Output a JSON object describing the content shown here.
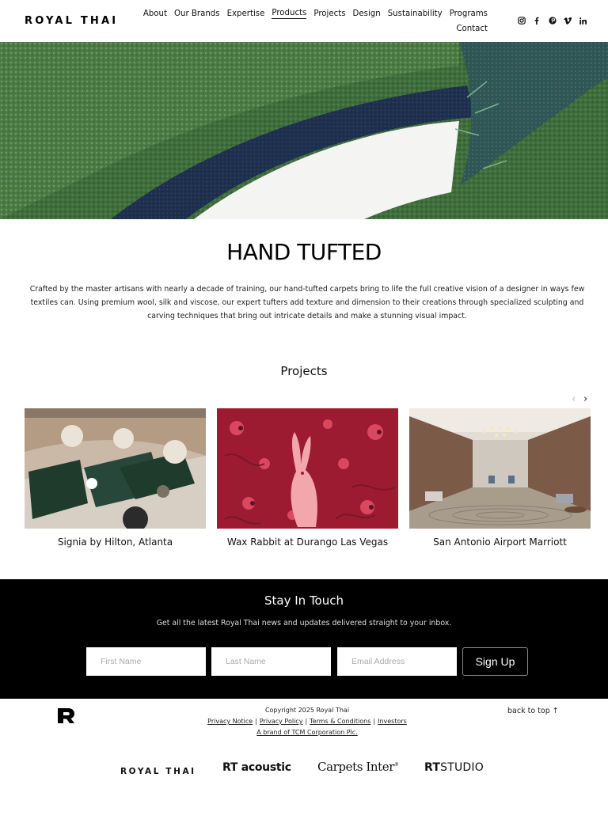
{
  "header": {
    "logo": "ROYAL THAI",
    "nav": [
      {
        "label": "About"
      },
      {
        "label": "Our Brands"
      },
      {
        "label": "Expertise"
      },
      {
        "label": "Products",
        "active": true
      },
      {
        "label": "Projects"
      },
      {
        "label": "Design"
      },
      {
        "label": "Sustainability"
      },
      {
        "label": "Programs"
      },
      {
        "label": "Contact"
      }
    ],
    "social": [
      "instagram-icon",
      "facebook-icon",
      "pinterest-icon",
      "vimeo-icon",
      "linkedin-icon"
    ]
  },
  "hero": {
    "image": "hand-tufted-carpet-closeup"
  },
  "section": {
    "title": "HAND TUFTED",
    "description": "Crafted by the master artisans with nearly a decade of training, our hand-tufted carpets bring to life the full creative vision of a designer in ways few textiles can. Using premium wool, silk and viscose, our expert tufters add texture and dimension to their creations through specialized sculpting and carving techniques that bring out intricate details and make a stunning visual impact."
  },
  "projects": {
    "heading": "Projects",
    "prev": "‹",
    "next": "›",
    "items": [
      {
        "caption": "Signia by Hilton, Atlanta"
      },
      {
        "caption": "Wax Rabbit at Durango Las Vegas"
      },
      {
        "caption": "San Antonio Airport Marriott"
      }
    ]
  },
  "newsletter": {
    "title": "Stay In Touch",
    "subtitle": "Get all the latest Royal Thai news and updates delivered straight to your inbox.",
    "first_name_placeholder": "First Name",
    "last_name_placeholder": "Last Name",
    "email_placeholder": "Email Address",
    "button": "Sign Up"
  },
  "footer": {
    "copyright": "Copyright 2025 Royal Thai",
    "links": [
      "Privacy Notice",
      "Privacy Policy",
      "Terms & Conditions",
      "Investors"
    ],
    "brand_line": "A brand of TCM Corporation Plc.",
    "back_to_top": "back to top ↑",
    "brands": {
      "royal": "ROYAL THAI",
      "acoustic_rt": "RT",
      "acoustic_word": "acoustic",
      "carpets": "Carpets Inter",
      "carpets_mark": "®",
      "studio_rt": "RT",
      "studio_word": "STUDIO"
    }
  }
}
